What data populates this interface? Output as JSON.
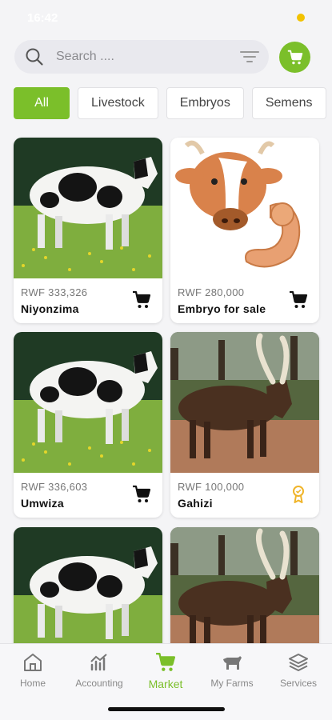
{
  "status": {
    "time": "16:42"
  },
  "search": {
    "placeholder": "Search ...."
  },
  "chips": [
    "All",
    "Livestock",
    "Embryos",
    "Semens"
  ],
  "products": [
    {
      "price": "RWF 333,326",
      "name": "Niyonzima",
      "image": "holstein-cow",
      "action": "cart-icon"
    },
    {
      "price": "RWF 280,000",
      "name": "Embryo for sale",
      "image": "cow-embryo-illustration",
      "action": "cart-icon"
    },
    {
      "price": "RWF 336,603",
      "name": "Umwiza",
      "image": "holstein-cow",
      "action": "cart-icon"
    },
    {
      "price": "RWF 100,000",
      "name": "Gahizi",
      "image": "ankole-bull",
      "action": "award-icon"
    },
    {
      "price": "",
      "name": "",
      "image": "holstein-cow",
      "action": ""
    },
    {
      "price": "",
      "name": "",
      "image": "ankole-bull",
      "action": ""
    }
  ],
  "nav": [
    "Home",
    "Accounting",
    "Market",
    "My Farms",
    "Services"
  ],
  "colors": {
    "accent": "#7bbf2a",
    "award": "#f0b429"
  }
}
